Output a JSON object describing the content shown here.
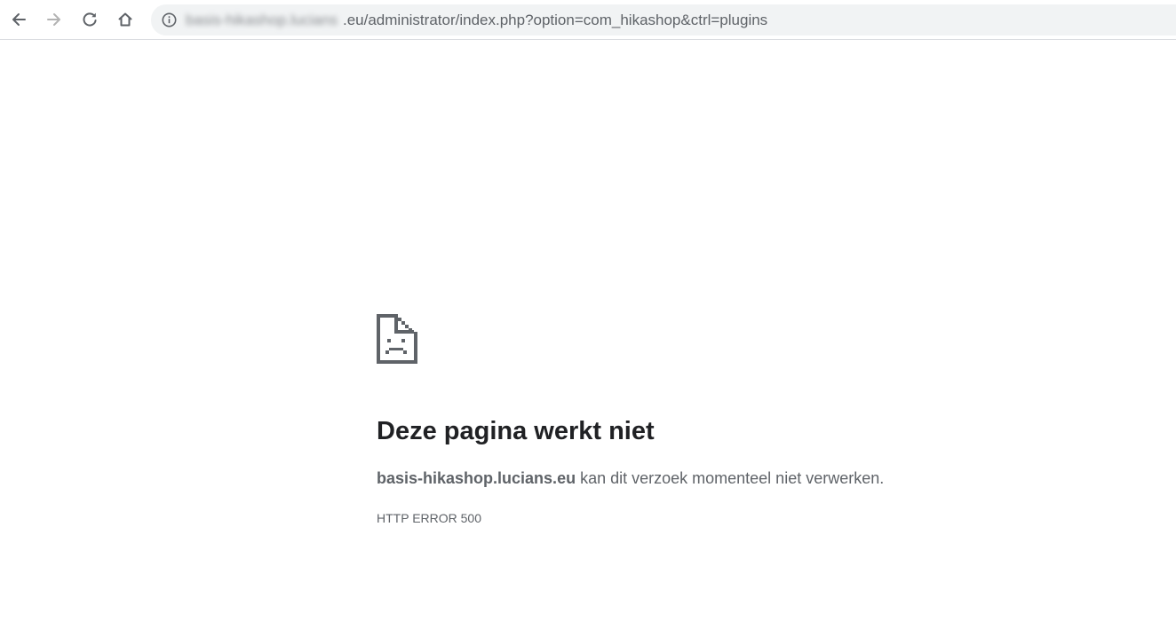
{
  "browser": {
    "toolbar": {
      "back_icon": "arrow-left-icon",
      "forward_icon": "arrow-right-icon",
      "reload_icon": "reload-icon",
      "home_icon": "home-icon",
      "info_icon": "info-icon"
    },
    "address_bar": {
      "host_blurred": "basis-hikashop.lucians",
      "url_rest": ".eu/administrator/index.php?option=com_hikashop&ctrl=plugins"
    }
  },
  "error_page": {
    "icon": "sad-page-icon",
    "heading": "Deze pagina werkt niet",
    "host": "basis-hikashop.lucians.eu",
    "message": " kan dit verzoek momenteel niet verwerken.",
    "error_code": "HTTP ERROR 500"
  },
  "colors": {
    "text_primary": "#202124",
    "text_secondary": "#5f6368",
    "omnibox_bg": "#f1f3f4",
    "forward_disabled": "#b3b3b3"
  }
}
